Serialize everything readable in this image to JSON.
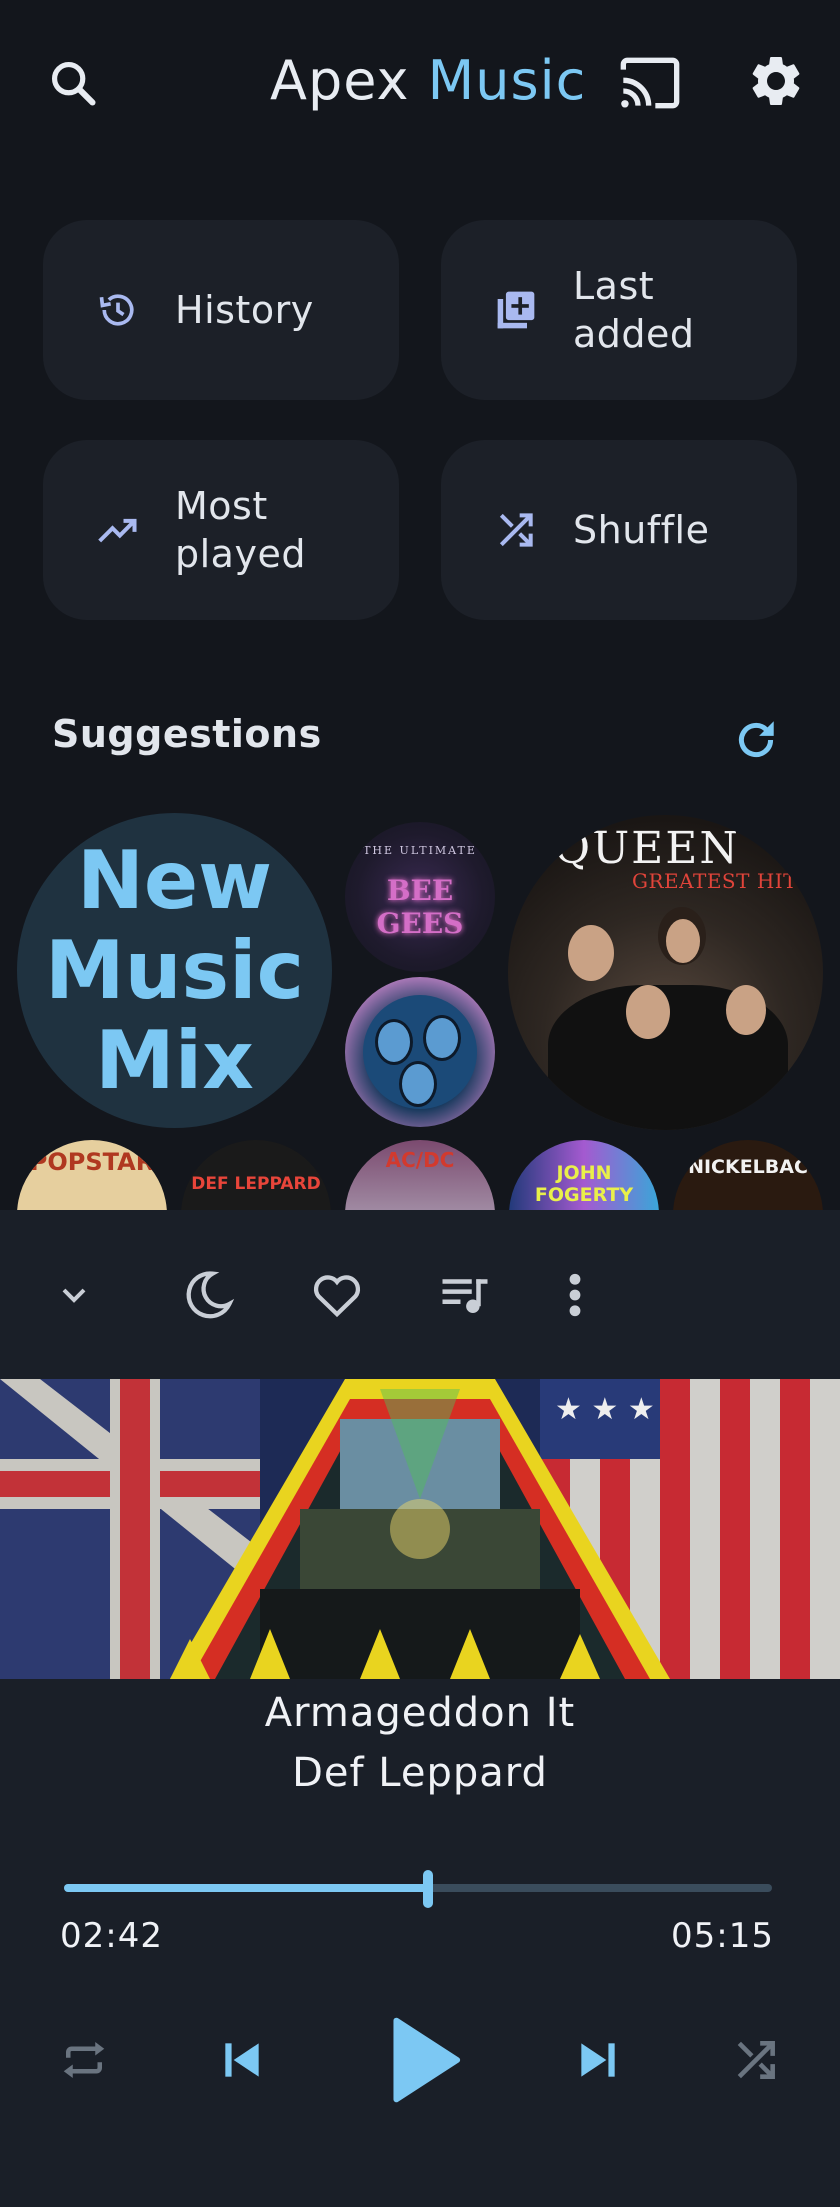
{
  "header": {
    "title_part1": "Apex",
    "title_part2": "Music",
    "icons": [
      "search-icon",
      "cast-icon",
      "settings-icon"
    ]
  },
  "quick_actions": [
    {
      "label": "History",
      "icon": "history-icon"
    },
    {
      "label": "Last added",
      "icon": "library-add-icon"
    },
    {
      "label": "Most played",
      "icon": "trending-up-icon"
    },
    {
      "label": "Shuffle",
      "icon": "shuffle-icon"
    }
  ],
  "suggestions": {
    "title": "Suggestions",
    "refresh_icon": "refresh-icon",
    "mix_label": "New Music Mix",
    "albums": [
      {
        "name": "bee-gees-album",
        "text_top": "THE ULTIMATE",
        "text_main": "BEE GEES"
      },
      {
        "name": "kiss-album"
      },
      {
        "name": "queen-album",
        "logo": "QUEEN",
        "subtitle": "GREATEST HITS"
      }
    ],
    "mini_albums": [
      {
        "name": "popstar-album",
        "text": "POPSTAR"
      },
      {
        "name": "def-leppard-album",
        "text": "DEF LEPPARD"
      },
      {
        "name": "acdc-album",
        "text": "AC/DC"
      },
      {
        "name": "john-fogerty-album",
        "text": "JOHN FOGERTY"
      },
      {
        "name": "nickelback-album",
        "text": "NICKELBAC"
      }
    ]
  },
  "player": {
    "song": "Armageddon It",
    "artist": "Def Leppard",
    "current_time": "02:42",
    "total_time": "05:15",
    "progress": 0.514,
    "accent_color": "#7cc8f3",
    "toolbar_icons": [
      "chevron-down-icon",
      "sleep-timer-icon",
      "favorite-icon",
      "queue-icon",
      "more-icon"
    ],
    "controls": [
      "repeat-icon",
      "previous-icon",
      "play-icon",
      "next-icon",
      "shuffle-icon"
    ]
  }
}
